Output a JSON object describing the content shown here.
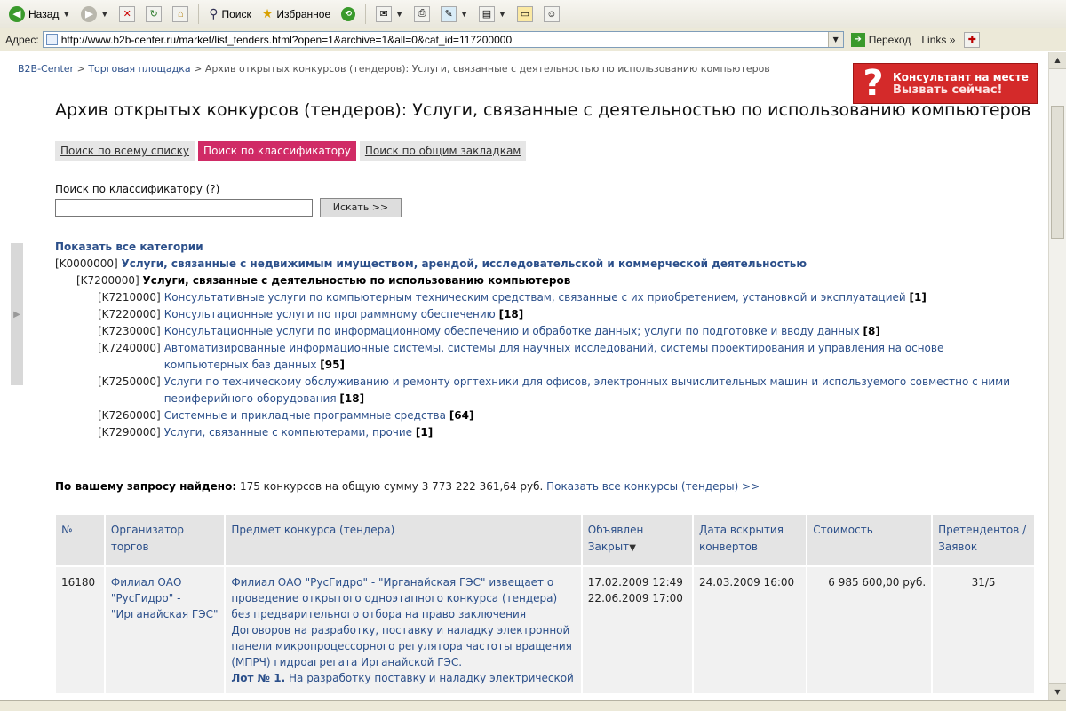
{
  "browser": {
    "toolbar": {
      "back_label": "Назад",
      "search_label": "Поиск",
      "favorites_label": "Избранное"
    },
    "address": {
      "label": "Адрес:",
      "url": "http://www.b2b-center.ru/market/list_tenders.html?open=1&archive=1&all=0&cat_id=117200000",
      "go_label": "Переход",
      "links_label": "Links"
    }
  },
  "page": {
    "breadcrumb": {
      "home": "B2B-Center",
      "sep": " > ",
      "market": "Торговая площадка",
      "current": "Архив открытых конкурсов (тендеров): Услуги, связанные с деятельностью по использованию компьютеров"
    },
    "consultant": {
      "line1": "Консультант на месте",
      "line2": "Вызвать сейчас!"
    },
    "title": "Архив открытых конкурсов (тендеров): Услуги, связанные с деятельностью по использованию компьютеров",
    "tabs": [
      {
        "label": "Поиск по всему списку",
        "active": false
      },
      {
        "label": "Поиск по классификатору",
        "active": true
      },
      {
        "label": "Поиск по общим закладкам",
        "active": false
      }
    ],
    "search": {
      "label": "Поиск по классификатору (?)",
      "value": "",
      "button": "Искать >>"
    },
    "categories": {
      "show_all": "Показать все категории",
      "level1": {
        "code": "[K0000000]",
        "label": "Услуги, связанные с недвижимым имуществом, арендой, исследовательской и коммерческой деятельностью"
      },
      "level2": {
        "code": "[K7200000]",
        "label": "Услуги, связанные с деятельностью по использованию компьютеров"
      },
      "items": [
        {
          "code": "[K7210000]",
          "label": "Консультативные услуги по компьютерным техническим средствам, связанные с их приобретением, установкой и эксплуатацией",
          "count": "[1]"
        },
        {
          "code": "[K7220000]",
          "label": "Консультационные услуги по программному обеспечению",
          "count": "[18]"
        },
        {
          "code": "[K7230000]",
          "label": "Консультационные услуги по информационному обеспечению и обработке данных; услуги по подготовке и вводу данных",
          "count": "[8]"
        },
        {
          "code": "[K7240000]",
          "label": "Автоматизированные информационные системы, системы для научных исследований, системы проектирования и управления на основе компьютерных баз данных",
          "count": "[95]"
        },
        {
          "code": "[K7250000]",
          "label": "Услуги по техническому обслуживанию и ремонту оргтехники для офисов, электронных вычислительных машин и используемого совместно с ними периферийного оборудования",
          "count": "[18]"
        },
        {
          "code": "[K7260000]",
          "label": "Системные и прикладные программные средства",
          "count": "[64]"
        },
        {
          "code": "[K7290000]",
          "label": "Услуги, связанные с компьютерами, прочие",
          "count": "[1]"
        }
      ]
    },
    "found": {
      "label": "По вашему запросу найдено:",
      "text": "175 конкурсов на общую сумму 3 773 222 361,64 руб.",
      "link": "Показать все конкурсы (тендеры) >>"
    },
    "table": {
      "headers": {
        "num": "№",
        "org": "Организатор торгов",
        "subject": "Предмет конкурса (тендера)",
        "announced": "Объявлен",
        "closed": "Закрыт",
        "sort_arrow": "▼",
        "opening": "Дата вскрытия конвертов",
        "cost": "Стоимость",
        "applicants": "Претендентов / Заявок"
      },
      "rows": [
        {
          "num": "16180",
          "org": "Филиал ОАО \"РусГидро\" - \"Ирганайская ГЭС\"",
          "subject": "Филиал ОАО \"РусГидро\" - \"Ирганайская ГЭС\" извещает о проведение открытого одноэтапного конкурса (тендера) без предварительного отбора на право заключения Договоров на разработку, поставку и наладку электронной панели микропроцессорного регулятора частоты вращения (МПРЧ) гидроагрегата Ирганайской ГЭС.",
          "lot_label": "Лот № 1.",
          "lot_text": "На разработку поставку и наладку электрической",
          "announced": "17.02.2009 12:49",
          "closed": "22.06.2009 17:00",
          "opening": "24.03.2009 16:00",
          "cost": "6 985 600,00 руб.",
          "applicants": "31/5"
        }
      ]
    }
  },
  "colors": {
    "link": "#2b4f8a",
    "active_tab": "#d02b66",
    "consultant_bg": "#d42a2a"
  }
}
